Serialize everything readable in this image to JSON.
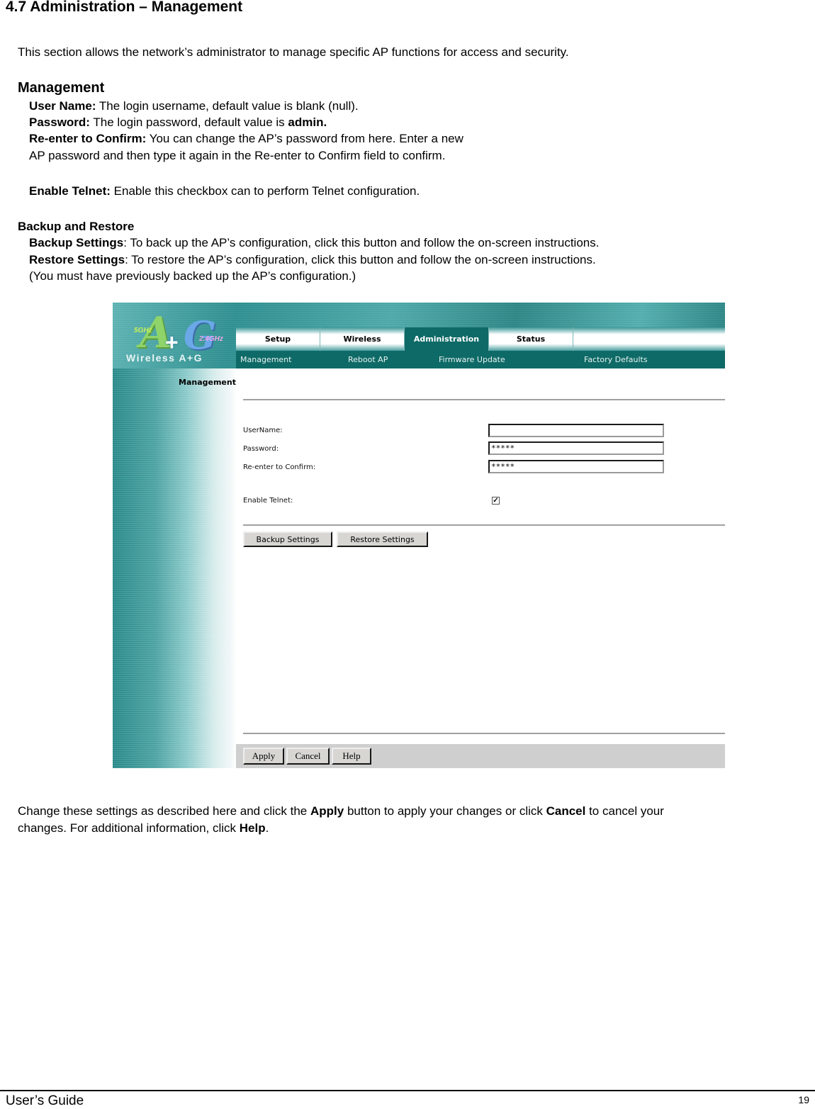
{
  "document": {
    "heading": "4.7 Administration – Management",
    "intro": "This section allows the network’s administrator to manage specific AP functions for access and security.",
    "management_heading": "Management",
    "user_name": {
      "term": "User Name:",
      "desc": " The login username, default value is blank (null)."
    },
    "password": {
      "term": "Password:",
      "desc": " The login password, default value is ",
      "value": "admin."
    },
    "reenter": {
      "term": "Re-enter to Confirm:",
      "desc": " You can change the AP’s password from here. Enter a new",
      "desc2": "AP password and then type it again in the Re-enter to Confirm field to confirm."
    },
    "telnet": {
      "term": "Enable Telnet:",
      "desc": " Enable this checkbox can to perform Telnet configuration."
    },
    "backup_heading": "Backup and Restore",
    "backup": {
      "term": "Backup Settings",
      "desc": ": To back up the AP’s configuration, click this button and follow the on-screen instructions."
    },
    "restore": {
      "term": "Restore Settings",
      "desc": ": To restore the AP’s configuration, click this button and follow the on-screen instructions."
    },
    "restore_note": "(You must have previously backed up the AP’s configuration.)",
    "outro": {
      "part1": "Change these settings as described here and click the ",
      "apply": "Apply",
      "part2": " button to apply your changes or click ",
      "cancel": "Cancel",
      "part3": " to cancel your",
      "line2_part1": "changes. For additional information, click ",
      "help": "Help",
      "line2_part2": "."
    },
    "footer": {
      "title": "User’s Guide",
      "page_number": "19"
    }
  },
  "screenshot": {
    "logo": {
      "big_a": "A",
      "plus": "+",
      "big_g": "G",
      "band1": "5GHz",
      "band2": "2.4GHz",
      "text": "Wireless A+G"
    },
    "tabs": [
      {
        "label": "Setup",
        "active": false
      },
      {
        "label": "Wireless",
        "active": false
      },
      {
        "label": "Administration",
        "active": true
      },
      {
        "label": "Status",
        "active": false
      }
    ],
    "subnav": [
      "Management",
      "Reboot AP",
      "Firmware Update",
      "Factory Defaults"
    ],
    "sidebar_title": "Management",
    "form": {
      "username_label": "UserName:",
      "username_value": "",
      "password_label": "Password:",
      "password_value": "*****",
      "confirm_label": "Re-enter to Confirm:",
      "confirm_value": "*****",
      "telnet_label": "Enable Telnet:",
      "telnet_checked": true,
      "telnet_check_glyph": "✓"
    },
    "buttons": {
      "backup": "Backup Settings",
      "restore": "Restore Settings",
      "apply": "Apply",
      "cancel": "Cancel",
      "help": "Help"
    },
    "colors": {
      "teal_dark": "#0e6a66",
      "teal_mid": "#2a8a8a",
      "button_face": "#d8d6d2",
      "bottom_bar": "#cfcfcf"
    }
  }
}
